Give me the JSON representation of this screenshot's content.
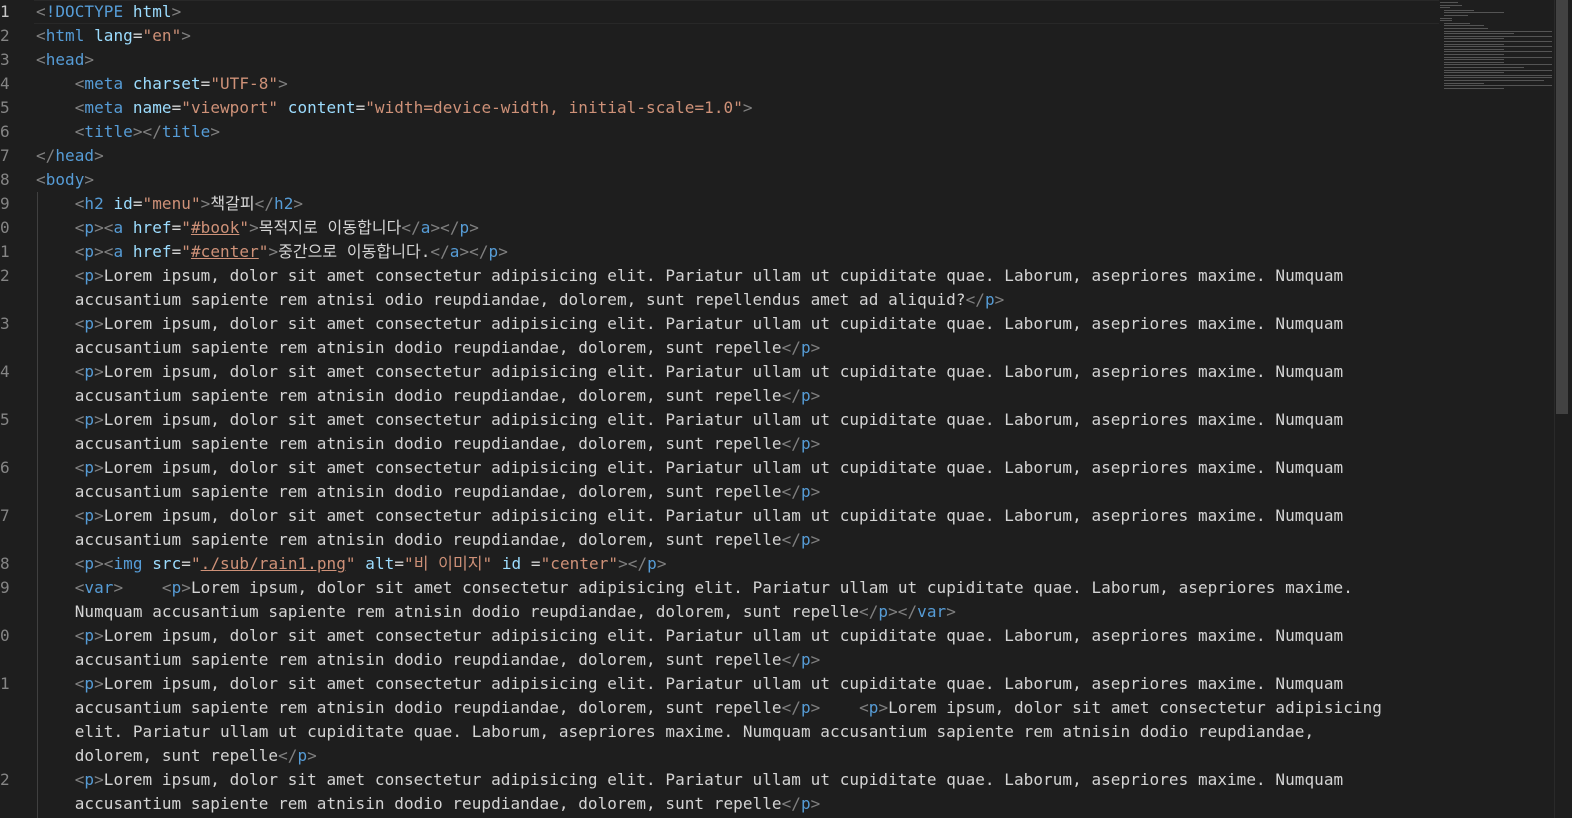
{
  "editor": {
    "line_numbers": [
      "1",
      "2",
      "3",
      "4",
      "5",
      "6",
      "7",
      "8",
      "9",
      "0",
      "1",
      "2",
      "3",
      "4",
      "5",
      "6",
      "7",
      "8",
      "9",
      "0",
      "1",
      "2"
    ],
    "lines": [
      [
        [
          "t-br",
          "<"
        ],
        [
          "t-tag",
          "!DOCTYPE"
        ],
        [
          "t-txt",
          " "
        ],
        [
          "t-attr",
          "html"
        ],
        [
          "t-br",
          ">"
        ]
      ],
      [
        [
          "t-br",
          "<"
        ],
        [
          "t-tag",
          "html"
        ],
        [
          "t-txt",
          " "
        ],
        [
          "t-attr",
          "lang"
        ],
        [
          "t-txt",
          "="
        ],
        [
          "t-str",
          "\"en\""
        ],
        [
          "t-br",
          ">"
        ]
      ],
      [
        [
          "t-br",
          "<"
        ],
        [
          "t-tag",
          "head"
        ],
        [
          "t-br",
          ">"
        ]
      ],
      [
        [
          "t-txt",
          "    "
        ],
        [
          "t-br",
          "<"
        ],
        [
          "t-tag",
          "meta"
        ],
        [
          "t-txt",
          " "
        ],
        [
          "t-attr",
          "charset"
        ],
        [
          "t-txt",
          "="
        ],
        [
          "t-str",
          "\"UTF-8\""
        ],
        [
          "t-br",
          ">"
        ]
      ],
      [
        [
          "t-txt",
          "    "
        ],
        [
          "t-br",
          "<"
        ],
        [
          "t-tag",
          "meta"
        ],
        [
          "t-txt",
          " "
        ],
        [
          "t-attr",
          "name"
        ],
        [
          "t-txt",
          "="
        ],
        [
          "t-str",
          "\"viewport\""
        ],
        [
          "t-txt",
          " "
        ],
        [
          "t-attr",
          "content"
        ],
        [
          "t-txt",
          "="
        ],
        [
          "t-str",
          "\"width=device-width, initial-scale=1.0\""
        ],
        [
          "t-br",
          ">"
        ]
      ],
      [
        [
          "t-txt",
          "    "
        ],
        [
          "t-br",
          "<"
        ],
        [
          "t-tag",
          "title"
        ],
        [
          "t-br",
          "></"
        ],
        [
          "t-tag",
          "title"
        ],
        [
          "t-br",
          ">"
        ]
      ],
      [
        [
          "t-br",
          "</"
        ],
        [
          "t-tag",
          "head"
        ],
        [
          "t-br",
          ">"
        ]
      ],
      [
        [
          "t-br",
          "<"
        ],
        [
          "t-tag",
          "body"
        ],
        [
          "t-br",
          ">"
        ]
      ],
      [
        [
          "t-txt",
          "    "
        ],
        [
          "t-br",
          "<"
        ],
        [
          "t-tag",
          "h2"
        ],
        [
          "t-txt",
          " "
        ],
        [
          "t-attr",
          "id"
        ],
        [
          "t-txt",
          "="
        ],
        [
          "t-str",
          "\"menu\""
        ],
        [
          "t-br",
          ">"
        ],
        [
          "t-txt",
          "책갈피"
        ],
        [
          "t-br",
          "</"
        ],
        [
          "t-tag",
          "h2"
        ],
        [
          "t-br",
          ">"
        ]
      ],
      [
        [
          "t-txt",
          "    "
        ],
        [
          "t-br",
          "<"
        ],
        [
          "t-tag",
          "p"
        ],
        [
          "t-br",
          "><"
        ],
        [
          "t-tag",
          "a"
        ],
        [
          "t-txt",
          " "
        ],
        [
          "t-attr",
          "href"
        ],
        [
          "t-txt",
          "="
        ],
        [
          "t-str",
          "\""
        ],
        [
          "t-link",
          "#book"
        ],
        [
          "t-str",
          "\""
        ],
        [
          "t-br",
          ">"
        ],
        [
          "t-txt",
          "목적지로 이동합니다"
        ],
        [
          "t-br",
          "</"
        ],
        [
          "t-tag",
          "a"
        ],
        [
          "t-br",
          "></"
        ],
        [
          "t-tag",
          "p"
        ],
        [
          "t-br",
          ">"
        ]
      ],
      [
        [
          "t-txt",
          "    "
        ],
        [
          "t-br",
          "<"
        ],
        [
          "t-tag",
          "p"
        ],
        [
          "t-br",
          "><"
        ],
        [
          "t-tag",
          "a"
        ],
        [
          "t-txt",
          " "
        ],
        [
          "t-attr",
          "href"
        ],
        [
          "t-txt",
          "="
        ],
        [
          "t-str",
          "\""
        ],
        [
          "t-link",
          "#center"
        ],
        [
          "t-str",
          "\""
        ],
        [
          "t-br",
          ">"
        ],
        [
          "t-txt",
          "중간으로 이동합니다."
        ],
        [
          "t-br",
          "</"
        ],
        [
          "t-tag",
          "a"
        ],
        [
          "t-br",
          "></"
        ],
        [
          "t-tag",
          "p"
        ],
        [
          "t-br",
          ">"
        ]
      ],
      [
        [
          "t-txt",
          "    "
        ],
        [
          "t-br",
          "<"
        ],
        [
          "t-tag",
          "p"
        ],
        [
          "t-br",
          ">"
        ],
        [
          "t-txt",
          "Lorem ipsum, dolor sit amet consectetur adipisicing elit. Pariatur ullam ut cupiditate quae. Laborum, asepriores maxime. Numquam"
        ]
      ],
      [
        [
          "t-txt",
          "    accusantium sapiente rem atnisi odio reupdiandae, dolorem, sunt repellendus amet ad aliquid?"
        ],
        [
          "t-br",
          "</"
        ],
        [
          "t-tag",
          "p"
        ],
        [
          "t-br",
          ">"
        ]
      ],
      [
        [
          "t-txt",
          "    "
        ],
        [
          "t-br",
          "<"
        ],
        [
          "t-tag",
          "p"
        ],
        [
          "t-br",
          ">"
        ],
        [
          "t-txt",
          "Lorem ipsum, dolor sit amet consectetur adipisicing elit. Pariatur ullam ut cupiditate quae. Laborum, asepriores maxime. Numquam"
        ]
      ],
      [
        [
          "t-txt",
          "    accusantium sapiente rem atnisin dodio reupdiandae, dolorem, sunt repelle"
        ],
        [
          "t-br",
          "</"
        ],
        [
          "t-tag",
          "p"
        ],
        [
          "t-br",
          ">"
        ]
      ],
      [
        [
          "t-txt",
          "    "
        ],
        [
          "t-br",
          "<"
        ],
        [
          "t-tag",
          "p"
        ],
        [
          "t-br",
          ">"
        ],
        [
          "t-txt",
          "Lorem ipsum, dolor sit amet consectetur adipisicing elit. Pariatur ullam ut cupiditate quae. Laborum, asepriores maxime. Numquam"
        ]
      ],
      [
        [
          "t-txt",
          "    accusantium sapiente rem atnisin dodio reupdiandae, dolorem, sunt repelle"
        ],
        [
          "t-br",
          "</"
        ],
        [
          "t-tag",
          "p"
        ],
        [
          "t-br",
          ">"
        ]
      ],
      [
        [
          "t-txt",
          "    "
        ],
        [
          "t-br",
          "<"
        ],
        [
          "t-tag",
          "p"
        ],
        [
          "t-br",
          ">"
        ],
        [
          "t-txt",
          "Lorem ipsum, dolor sit amet consectetur adipisicing elit. Pariatur ullam ut cupiditate quae. Laborum, asepriores maxime. Numquam"
        ]
      ],
      [
        [
          "t-txt",
          "    accusantium sapiente rem atnisin dodio reupdiandae, dolorem, sunt repelle"
        ],
        [
          "t-br",
          "</"
        ],
        [
          "t-tag",
          "p"
        ],
        [
          "t-br",
          ">"
        ]
      ],
      [
        [
          "t-txt",
          "    "
        ],
        [
          "t-br",
          "<"
        ],
        [
          "t-tag",
          "p"
        ],
        [
          "t-br",
          ">"
        ],
        [
          "t-txt",
          "Lorem ipsum, dolor sit amet consectetur adipisicing elit. Pariatur ullam ut cupiditate quae. Laborum, asepriores maxime. Numquam"
        ]
      ],
      [
        [
          "t-txt",
          "    accusantium sapiente rem atnisin dodio reupdiandae, dolorem, sunt repelle"
        ],
        [
          "t-br",
          "</"
        ],
        [
          "t-tag",
          "p"
        ],
        [
          "t-br",
          ">"
        ]
      ],
      [
        [
          "t-txt",
          "    "
        ],
        [
          "t-br",
          "<"
        ],
        [
          "t-tag",
          "p"
        ],
        [
          "t-br",
          ">"
        ],
        [
          "t-txt",
          "Lorem ipsum, dolor sit amet consectetur adipisicing elit. Pariatur ullam ut cupiditate quae. Laborum, asepriores maxime. Numquam"
        ]
      ],
      [
        [
          "t-txt",
          "    accusantium sapiente rem atnisin dodio reupdiandae, dolorem, sunt repelle"
        ],
        [
          "t-br",
          "</"
        ],
        [
          "t-tag",
          "p"
        ],
        [
          "t-br",
          ">"
        ]
      ],
      [
        [
          "t-txt",
          "    "
        ],
        [
          "t-br",
          "<"
        ],
        [
          "t-tag",
          "p"
        ],
        [
          "t-br",
          "><"
        ],
        [
          "t-tag",
          "img"
        ],
        [
          "t-txt",
          " "
        ],
        [
          "t-attr",
          "src"
        ],
        [
          "t-txt",
          "="
        ],
        [
          "t-str",
          "\""
        ],
        [
          "t-link",
          "./sub/rain1.png"
        ],
        [
          "t-str",
          "\""
        ],
        [
          "t-txt",
          " "
        ],
        [
          "t-attr",
          "alt"
        ],
        [
          "t-txt",
          "="
        ],
        [
          "t-str",
          "\"비 이미지\""
        ],
        [
          "t-txt",
          " "
        ],
        [
          "t-attr",
          "id"
        ],
        [
          "t-txt",
          " ="
        ],
        [
          "t-str",
          "\"center\""
        ],
        [
          "t-br",
          "></"
        ],
        [
          "t-tag",
          "p"
        ],
        [
          "t-br",
          ">"
        ]
      ],
      [
        [
          "t-txt",
          "    "
        ],
        [
          "t-br",
          "<"
        ],
        [
          "t-tag",
          "var"
        ],
        [
          "t-br",
          ">"
        ],
        [
          "t-txt",
          "    "
        ],
        [
          "t-br",
          "<"
        ],
        [
          "t-tag",
          "p"
        ],
        [
          "t-br",
          ">"
        ],
        [
          "t-txt",
          "Lorem ipsum, dolor sit amet consectetur adipisicing elit. Pariatur ullam ut cupiditate quae. Laborum, asepriores maxime."
        ]
      ],
      [
        [
          "t-txt",
          "    Numquam accusantium sapiente rem atnisin dodio reupdiandae, dolorem, sunt repelle"
        ],
        [
          "t-br",
          "</"
        ],
        [
          "t-tag",
          "p"
        ],
        [
          "t-br",
          "></"
        ],
        [
          "t-tag",
          "var"
        ],
        [
          "t-br",
          ">"
        ]
      ],
      [
        [
          "t-txt",
          "    "
        ],
        [
          "t-br",
          "<"
        ],
        [
          "t-tag",
          "p"
        ],
        [
          "t-br",
          ">"
        ],
        [
          "t-txt",
          "Lorem ipsum, dolor sit amet consectetur adipisicing elit. Pariatur ullam ut cupiditate quae. Laborum, asepriores maxime. Numquam"
        ]
      ],
      [
        [
          "t-txt",
          "    accusantium sapiente rem atnisin dodio reupdiandae, dolorem, sunt repelle"
        ],
        [
          "t-br",
          "</"
        ],
        [
          "t-tag",
          "p"
        ],
        [
          "t-br",
          ">"
        ]
      ],
      [
        [
          "t-txt",
          "    "
        ],
        [
          "t-br",
          "<"
        ],
        [
          "t-tag",
          "p"
        ],
        [
          "t-br",
          ">"
        ],
        [
          "t-txt",
          "Lorem ipsum, dolor sit amet consectetur adipisicing elit. Pariatur ullam ut cupiditate quae. Laborum, asepriores maxime. Numquam"
        ]
      ],
      [
        [
          "t-txt",
          "    accusantium sapiente rem atnisin dodio reupdiandae, dolorem, sunt repelle"
        ],
        [
          "t-br",
          "</"
        ],
        [
          "t-tag",
          "p"
        ],
        [
          "t-br",
          ">"
        ],
        [
          "t-txt",
          "    "
        ],
        [
          "t-br",
          "<"
        ],
        [
          "t-tag",
          "p"
        ],
        [
          "t-br",
          ">"
        ],
        [
          "t-txt",
          "Lorem ipsum, dolor sit amet consectetur adipisicing"
        ]
      ],
      [
        [
          "t-txt",
          "    elit. Pariatur ullam ut cupiditate quae. Laborum, asepriores maxime. Numquam accusantium sapiente rem atnisin dodio reupdiandae,"
        ]
      ],
      [
        [
          "t-txt",
          "    dolorem, sunt repelle"
        ],
        [
          "t-br",
          "</"
        ],
        [
          "t-tag",
          "p"
        ],
        [
          "t-br",
          ">"
        ]
      ],
      [
        [
          "t-txt",
          "    "
        ],
        [
          "t-br",
          "<"
        ],
        [
          "t-tag",
          "p"
        ],
        [
          "t-br",
          ">"
        ],
        [
          "t-txt",
          "Lorem ipsum, dolor sit amet consectetur adipisicing elit. Pariatur ullam ut cupiditate quae. Laborum, asepriores maxime. Numquam"
        ]
      ],
      [
        [
          "t-txt",
          "    accusantium sapiente rem atnisin dodio reupdiandae, dolorem, sunt repelle"
        ],
        [
          "t-br",
          "</"
        ],
        [
          "t-tag",
          "p"
        ],
        [
          "t-br",
          ">"
        ]
      ]
    ],
    "line_number_rows": [
      0,
      1,
      2,
      3,
      4,
      5,
      6,
      7,
      8,
      9,
      10,
      11,
      13,
      15,
      17,
      19,
      21,
      23,
      24,
      26,
      28,
      32
    ]
  }
}
